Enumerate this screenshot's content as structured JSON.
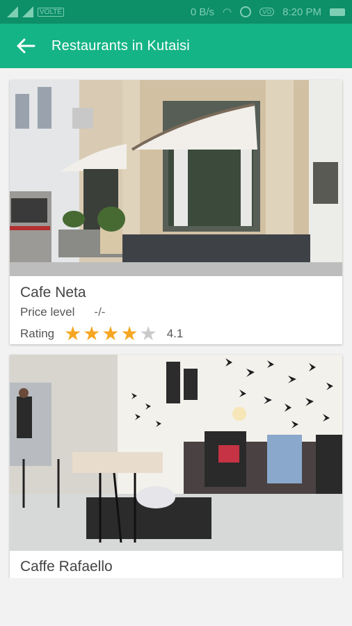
{
  "status_bar": {
    "volte": "VOLTE",
    "net_speed": "0 B/s",
    "vo_badge": "VO",
    "time": "8:20 PM"
  },
  "app_bar": {
    "title": "Restaurants in Kutaisi",
    "back_icon": "arrow-left-icon"
  },
  "colors": {
    "status_bar": "#0d8f68",
    "app_bar": "#14b486",
    "star_filled": "#f6a623",
    "star_empty": "#c9c9c9"
  },
  "restaurants": [
    {
      "name": "Cafe Neta",
      "price_label": "Price level",
      "price_value": "-/-",
      "rating_label": "Rating",
      "rating": 4.1,
      "rating_text": "4.1",
      "stars_filled": 4,
      "stars_total": 5
    },
    {
      "name": "Caffe Rafaello"
    }
  ]
}
